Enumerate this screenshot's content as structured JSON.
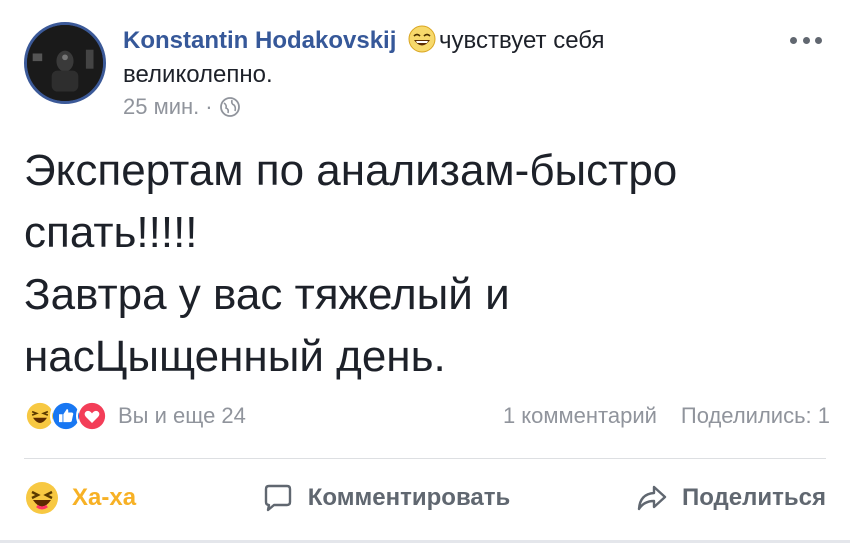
{
  "post": {
    "author": "Konstantin Hodakovskij",
    "feeling_text": "чувствует себя",
    "feeling_value": "великолепно.",
    "time": "25 мин.",
    "time_sep": "·",
    "text": "Экспертам по анализам-быстро\nспать!!!!!\nЗавтра у вас тяжелый и\nнасЦыщенный день."
  },
  "reactions": {
    "icons": [
      "haha-icon",
      "like-icon",
      "love-icon"
    ],
    "count_label": "Вы и еще 24",
    "comments_label": "1 комментарий",
    "shares_label": "Поделились: 1"
  },
  "actions": {
    "haha_label": "Ха-ха",
    "comment_label": "Комментировать",
    "share_label": "Поделиться"
  },
  "colors": {
    "author": "#365899",
    "haha": "#f7b125",
    "like": "#1877f2",
    "love": "#f33e58",
    "muted": "#90949c"
  }
}
